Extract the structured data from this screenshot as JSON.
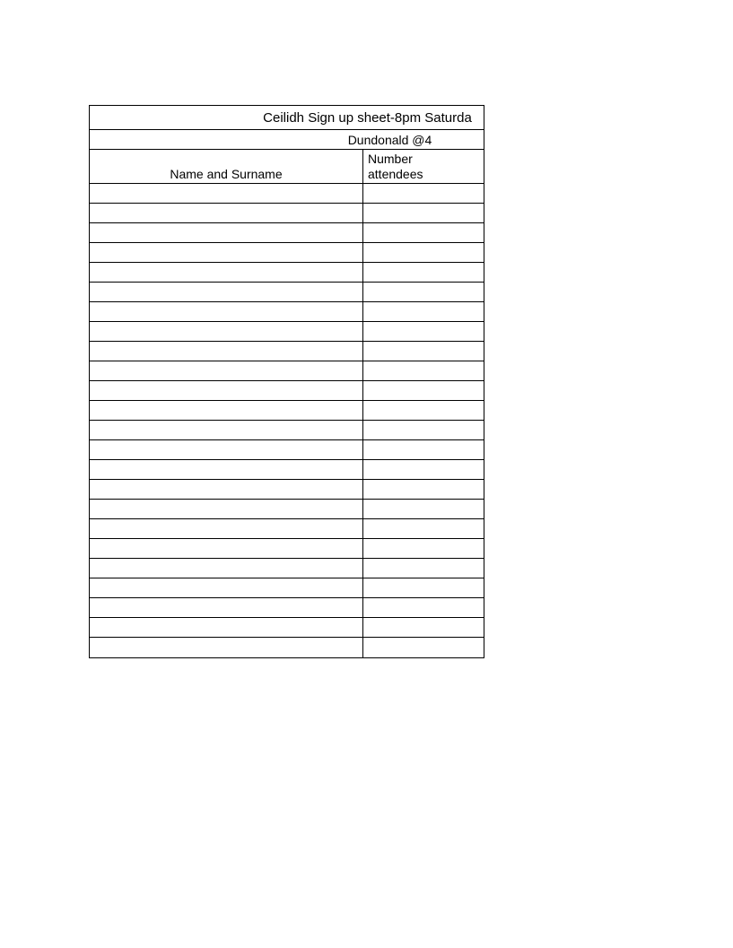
{
  "title": "Ceilidh Sign up sheet-8pm Saturda",
  "subtitle": "Dundonald @4",
  "columns": {
    "name": "Name and Surname",
    "number": "Number\nattendees"
  },
  "rowCount": 24
}
